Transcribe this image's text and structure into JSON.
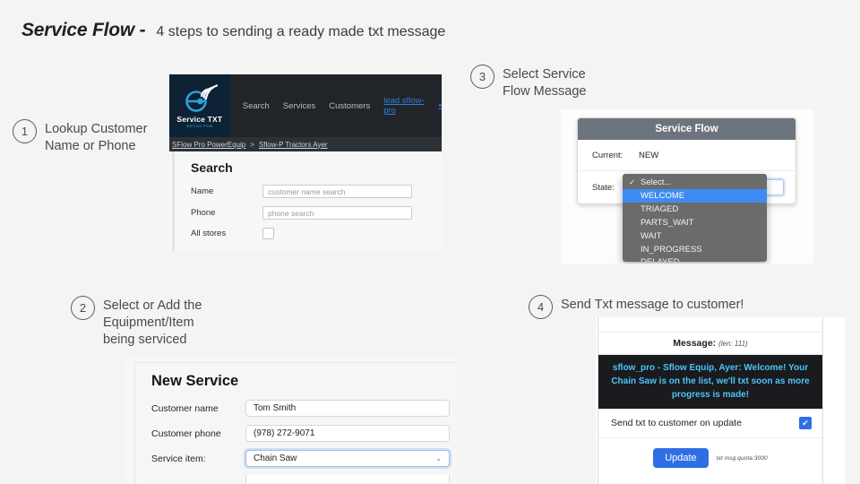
{
  "title": {
    "main": "Service Flow -",
    "subtitle": "4 steps to sending a ready made txt message"
  },
  "steps": [
    {
      "number": "1",
      "label": "Lookup Customer\nName or Phone"
    },
    {
      "number": "2",
      "label": "Select or Add the\nEquipment/Item\nbeing serviced"
    },
    {
      "number": "3",
      "label": "Select Service\nFlow Message"
    },
    {
      "number": "4",
      "label": "Send Txt message to customer!"
    }
  ],
  "panel1": {
    "logo": {
      "title": "Service TXT",
      "subtitle": "Service Flow"
    },
    "nav": {
      "links": [
        "Search",
        "Services",
        "Customers"
      ],
      "user": "lead sflow-pro",
      "caret": "▾"
    },
    "breadcrumb": {
      "first": "SFlow Pro PowerEquip",
      "separator": ">",
      "second": "Sflow-P Tractors Ayer"
    },
    "heading": "Search",
    "fields": [
      {
        "label": "Name",
        "placeholder": "customer name search"
      },
      {
        "label": "Phone",
        "placeholder": "phone search"
      }
    ],
    "checkbox_label": "All stores"
  },
  "panel2": {
    "heading": "New Service",
    "fields": [
      {
        "label": "Customer name",
        "value": "Tom Smith"
      },
      {
        "label": "Customer phone",
        "value": "(978) 272-9071"
      },
      {
        "label": "Service item:",
        "value": "Chain Saw",
        "caret": "⌄"
      }
    ]
  },
  "panel3": {
    "card_title": "Service Flow",
    "current_label": "Current:",
    "current_value": "NEW",
    "state_label": "State:",
    "options": [
      "Select...",
      "WELCOME",
      "TRIAGED",
      "PARTS_WAIT",
      "WAIT",
      "IN_PROGRESS",
      "DELAYED"
    ],
    "checked_option": "Select...",
    "highlighted_option": "WELCOME"
  },
  "panel4": {
    "message_label": "Message:",
    "message_len": "(len: 111)",
    "message_body": "sflow_pro - Sflow Equip, Ayer: Welcome! Your Chain Saw is on the list, we'll txt soon as more progress is made!",
    "send_label": "Send txt to customer on update",
    "send_checked": "✔",
    "update_button": "Update",
    "quota": "txt msg quota:3000"
  },
  "colors": {
    "page_bg": "#f4f4f4",
    "navbar": "#212529",
    "logo_bg": "#0d2235",
    "accent_blue": "#2f6fe4",
    "card_header": "#6c757d",
    "message_bg": "#191b1e",
    "message_text": "#4fc3f7",
    "dropdown_bg": "#6b6b6b",
    "dropdown_highlight": "#3f8bf3"
  }
}
